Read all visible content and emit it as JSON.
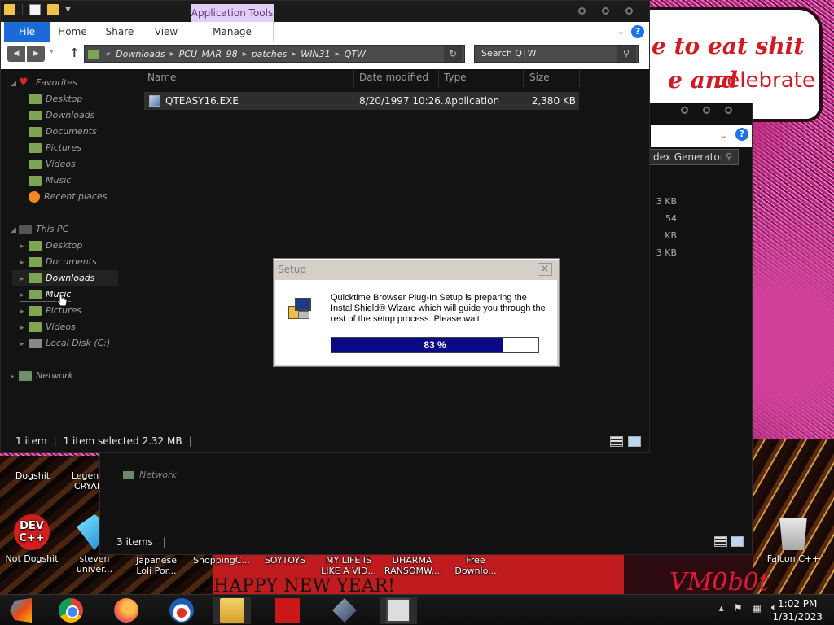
{
  "wallpaper": {
    "banner_line1": "e to eat shit",
    "banner_line2a": "e and",
    "banner_line2b": "celebrate",
    "bottom_text": "HAPPY NEW YEAR!",
    "vm_text": "VM0b0t"
  },
  "desktop_icons": [
    {
      "label": "Dogshit"
    },
    {
      "label": "Legend CRYAL"
    },
    {
      "label": "Not Dogshit",
      "icon": "dev-cpp-icon",
      "badge": "DEV C++"
    },
    {
      "label": "steven univer...",
      "icon": "gem-icon"
    },
    {
      "label": "Japanese Loli Por..."
    },
    {
      "label": "ShoppingC..."
    },
    {
      "label": "SOYTOYS"
    },
    {
      "label": "MY LIFE IS LIKE A VID..."
    },
    {
      "label": "DHARMA RANSOMW..."
    },
    {
      "label": "Free Downlo..."
    },
    {
      "label": "Falcon C++",
      "icon": "recycle-bin-icon"
    }
  ],
  "window2": {
    "search_value": "dex Generator",
    "sizes": [
      "3 KB",
      "54 KB",
      "3 KB"
    ],
    "network": "Network",
    "status": "3 items",
    "status_sep": "|"
  },
  "explorer": {
    "context_tab": "Application Tools",
    "tabs": {
      "file": "File",
      "home": "Home",
      "share": "Share",
      "view": "View",
      "manage": "Manage"
    },
    "address": {
      "prefix": "«",
      "crumbs": [
        "Downloads",
        "PCU_MAR_98",
        "patches",
        "WIN31",
        "QTW"
      ],
      "crumb_sep": "▸"
    },
    "search_placeholder": "Search QTW",
    "nav": {
      "favorites": "Favorites",
      "fav_items": [
        "Desktop",
        "Downloads",
        "Documents",
        "Pictures",
        "Videos",
        "Music",
        "Recent places"
      ],
      "this_pc": "This PC",
      "pc_items": [
        "Desktop",
        "Documents",
        "Downloads",
        "Music",
        "Pictures",
        "Videos",
        "Local Disk (C:)"
      ],
      "network": "Network"
    },
    "columns": {
      "name": "Name",
      "date": "Date modified",
      "type": "Type",
      "size": "Size"
    },
    "file": {
      "name": "QTEASY16.EXE",
      "date": "8/20/1997 10:26...",
      "type": "Application",
      "size": "2,380 KB"
    },
    "status": {
      "count": "1 item",
      "sep1": "|",
      "selected": "1 item selected  2.32 MB",
      "sep2": "|"
    }
  },
  "dialog": {
    "title": "Setup",
    "close": "×",
    "message": "Quicktime Browser Plug-In Setup is preparing the InstallShield® Wizard which will guide you through the rest of the setup process.  Please wait.",
    "progress": 0.83,
    "progress_label": "83 %"
  },
  "taskbar": {
    "time": "1:02 PM",
    "date": "1/31/2023"
  },
  "colors": {
    "file_tab": "#1a6ad8",
    "context_tab": "#e2cef4",
    "progress_fill": "#0a0a84"
  }
}
